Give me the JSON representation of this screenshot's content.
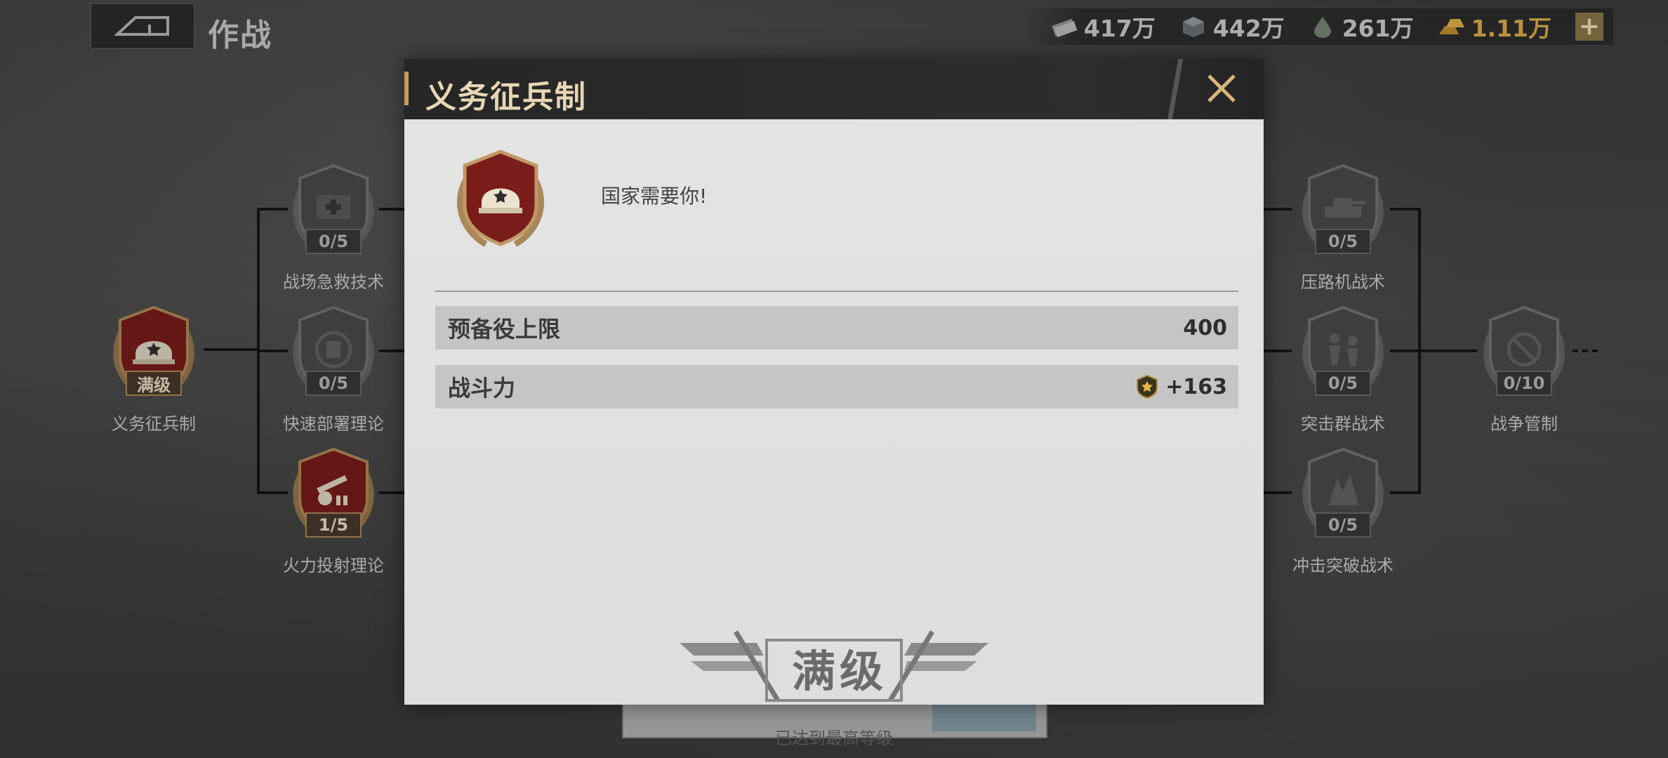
{
  "header": {
    "title": "作战",
    "resources": [
      {
        "icon": "cash-stack-icon",
        "value": "417万"
      },
      {
        "icon": "steel-cube-icon",
        "value": "442万"
      },
      {
        "icon": "fuel-drop-icon",
        "value": "261万"
      },
      {
        "icon": "gold-bars-icon",
        "value": "1.11万"
      }
    ],
    "plus_label": "+"
  },
  "tree": {
    "root": {
      "name": "义务征兵制",
      "level": "满级",
      "icon": "helmet-icon"
    },
    "left_column": [
      {
        "name": "战场急救技术",
        "level": "0/5",
        "icon": "medkit-icon"
      },
      {
        "name": "快速部署理论",
        "level": "0/5",
        "icon": "clipboard-icon"
      },
      {
        "name": "火力投射理论",
        "level": "1/5",
        "icon": "artillery-icon"
      }
    ],
    "right_column": [
      {
        "name": "压路机战术",
        "level": "0/5",
        "icon": "tank-icon"
      },
      {
        "name": "突击群战术",
        "level": "0/5",
        "icon": "soldiers-icon"
      },
      {
        "name": "冲击突破战术",
        "level": "0/5",
        "icon": "explosion-icon"
      }
    ],
    "far_right": {
      "name": "战争管制",
      "level": "0/10",
      "icon": "control-icon"
    }
  },
  "modal": {
    "title": "义务征兵制",
    "description": "国家需要你!",
    "stats": [
      {
        "label": "预备役上限",
        "value": "400"
      },
      {
        "label": "战斗力",
        "value": "+163",
        "icon": "power-star-icon"
      }
    ],
    "max_label": "满级",
    "max_sub": "已达到最高等级"
  },
  "colors": {
    "accent_gold": "#c49a5d",
    "badge_red": "#7a1d1a",
    "gold_text": "#e2b34a"
  }
}
